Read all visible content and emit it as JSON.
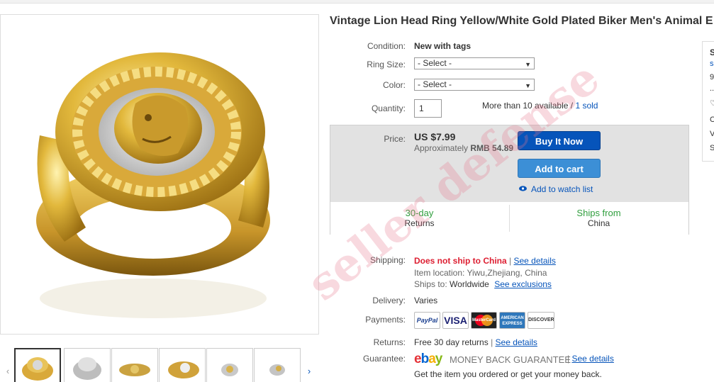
{
  "listing": {
    "title": "Vintage Lion Head Ring Yellow/White Gold Plated Biker Men's Animal E",
    "condition_label": "Condition:",
    "condition_value": "New with tags",
    "ring_size_label": "Ring Size:",
    "ring_size_value": "- Select -",
    "color_label": "Color:",
    "color_value": "- Select -",
    "quantity_label": "Quantity:",
    "quantity_value": "1",
    "availability": "More than 10 available /",
    "sold": "1 sold"
  },
  "price": {
    "label": "Price:",
    "value": "US $7.99",
    "approx_prefix": "Approximately",
    "approx_value": "RMB 54.89",
    "buy_now": "Buy It Now",
    "add_to_cart": "Add to cart",
    "watch": "Add to watch list",
    "returns_days": "30-day",
    "returns_label": "Returns",
    "ships_from_label": "Ships from",
    "ships_from_value": "China"
  },
  "shipping": {
    "label": "Shipping:",
    "not_ship": "Does not ship to China",
    "see_details": "See details",
    "item_location": "Item location:",
    "item_location_value": "Yiwu,Zhejiang, China",
    "ships_to": "Ships to:",
    "ships_to_value": "Worldwide",
    "see_exclusions": "See exclusions"
  },
  "delivery": {
    "label": "Delivery:",
    "value": "Varies"
  },
  "payments": {
    "label": "Payments:",
    "logos": [
      "PayPal",
      "VISA",
      "MasterCard",
      "AMERICAN EXPRESS",
      "DISCOVER"
    ]
  },
  "returns": {
    "label": "Returns:",
    "value": "Free 30 day returns",
    "see_details": "See details"
  },
  "guarantee": {
    "label": "Guarantee:",
    "ebay": [
      "e",
      "b",
      "a",
      "y"
    ],
    "mbg": "MONEY BACK GUARANTEE",
    "see_details": "See details",
    "text": "Get the item you ordered or get your money back."
  },
  "watermark": "seller defense",
  "seller_card": {
    "letters": [
      "S",
      "s",
      "9",
      "..",
      "♡",
      "C",
      "V",
      "S"
    ]
  },
  "colors": {
    "link": "#0654ba",
    "buy_button": "#0654ba",
    "cart_button": "#3c8fd6",
    "error": "#dd1e31",
    "green": "#2f9e3d"
  }
}
